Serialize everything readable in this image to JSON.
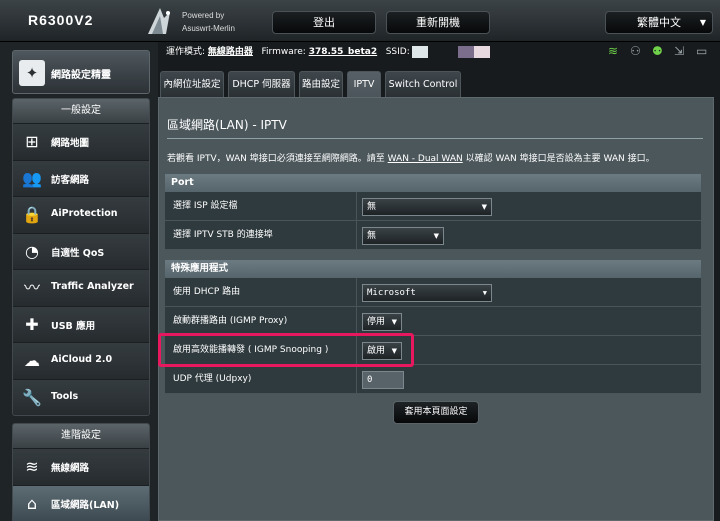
{
  "header": {
    "model": "R6300V2",
    "powered_by": "Powered by",
    "firmware_brand": "Asuswrt-Merlin",
    "logout": "登出",
    "reboot": "重新開機",
    "language": "繁體中文"
  },
  "sidebar": {
    "quick_setup": "網路設定精靈",
    "general_head": "一般設定",
    "general_items": [
      {
        "label": "網路地圖",
        "icon": "network-map-icon"
      },
      {
        "label": "訪客網路",
        "icon": "guest-network-icon"
      },
      {
        "label": "AiProtection",
        "icon": "aiprotection-lock-icon"
      },
      {
        "label": "自適性 QoS",
        "icon": "qos-gauge-icon"
      },
      {
        "label": "Traffic Analyzer",
        "icon": "traffic-analyzer-icon"
      },
      {
        "label": "USB 應用",
        "icon": "usb-puzzle-icon"
      },
      {
        "label": "AiCloud 2.0",
        "icon": "aicloud-icon"
      },
      {
        "label": "Tools",
        "icon": "wrench-icon"
      }
    ],
    "advanced_head": "進階設定",
    "advanced_items": [
      {
        "label": "無線網路",
        "icon": "wireless-icon"
      },
      {
        "label": "區域網路(LAN)",
        "icon": "home-lan-icon"
      }
    ]
  },
  "status": {
    "op_mode_label": "運作模式:",
    "op_mode_value": "無線路由器",
    "firmware_label": "Firmware:",
    "firmware_value": "378.55_beta2",
    "ssid_label": "SSID:"
  },
  "tabs": [
    {
      "label": "內網位址設定",
      "active": false
    },
    {
      "label": "DHCP 伺服器",
      "active": false
    },
    {
      "label": "路由設定",
      "active": false
    },
    {
      "label": "IPTV",
      "active": true
    },
    {
      "label": "Switch Control",
      "active": false
    }
  ],
  "page": {
    "title": "區域網路(LAN) - IPTV",
    "desc_prefix": "若觀看 IPTV，WAN 埠接口必須連接至網際網路。請至",
    "desc_link": "WAN - Dual WAN",
    "desc_suffix": "以確認 WAN 埠接口是否設為主要 WAN 接口。"
  },
  "port_section": {
    "head": "Port",
    "isp_profile_label": "選擇 ISP 設定檔",
    "isp_profile_value": "無",
    "stb_port_label": "選擇 IPTV STB 的連接埠",
    "stb_port_value": "無"
  },
  "special_section": {
    "head": "特殊應用程式",
    "dhcp_routes_label": "使用 DHCP 路由",
    "dhcp_routes_value": "Microsoft",
    "igmp_proxy_label": "啟動群播路由 (IGMP Proxy)",
    "igmp_proxy_value": "停用",
    "igmp_snooping_label": "啟用高效能播轉發 ( IGMP Snooping )",
    "igmp_snooping_value": "啟用",
    "udpxy_label": "UDP 代理 (Udpxy)",
    "udpxy_value": "0"
  },
  "apply": "套用本頁面設定",
  "colors": {
    "highlight": "#e7185d",
    "content_bg": "#4c575c",
    "row_bg": "#2f3a3e"
  }
}
